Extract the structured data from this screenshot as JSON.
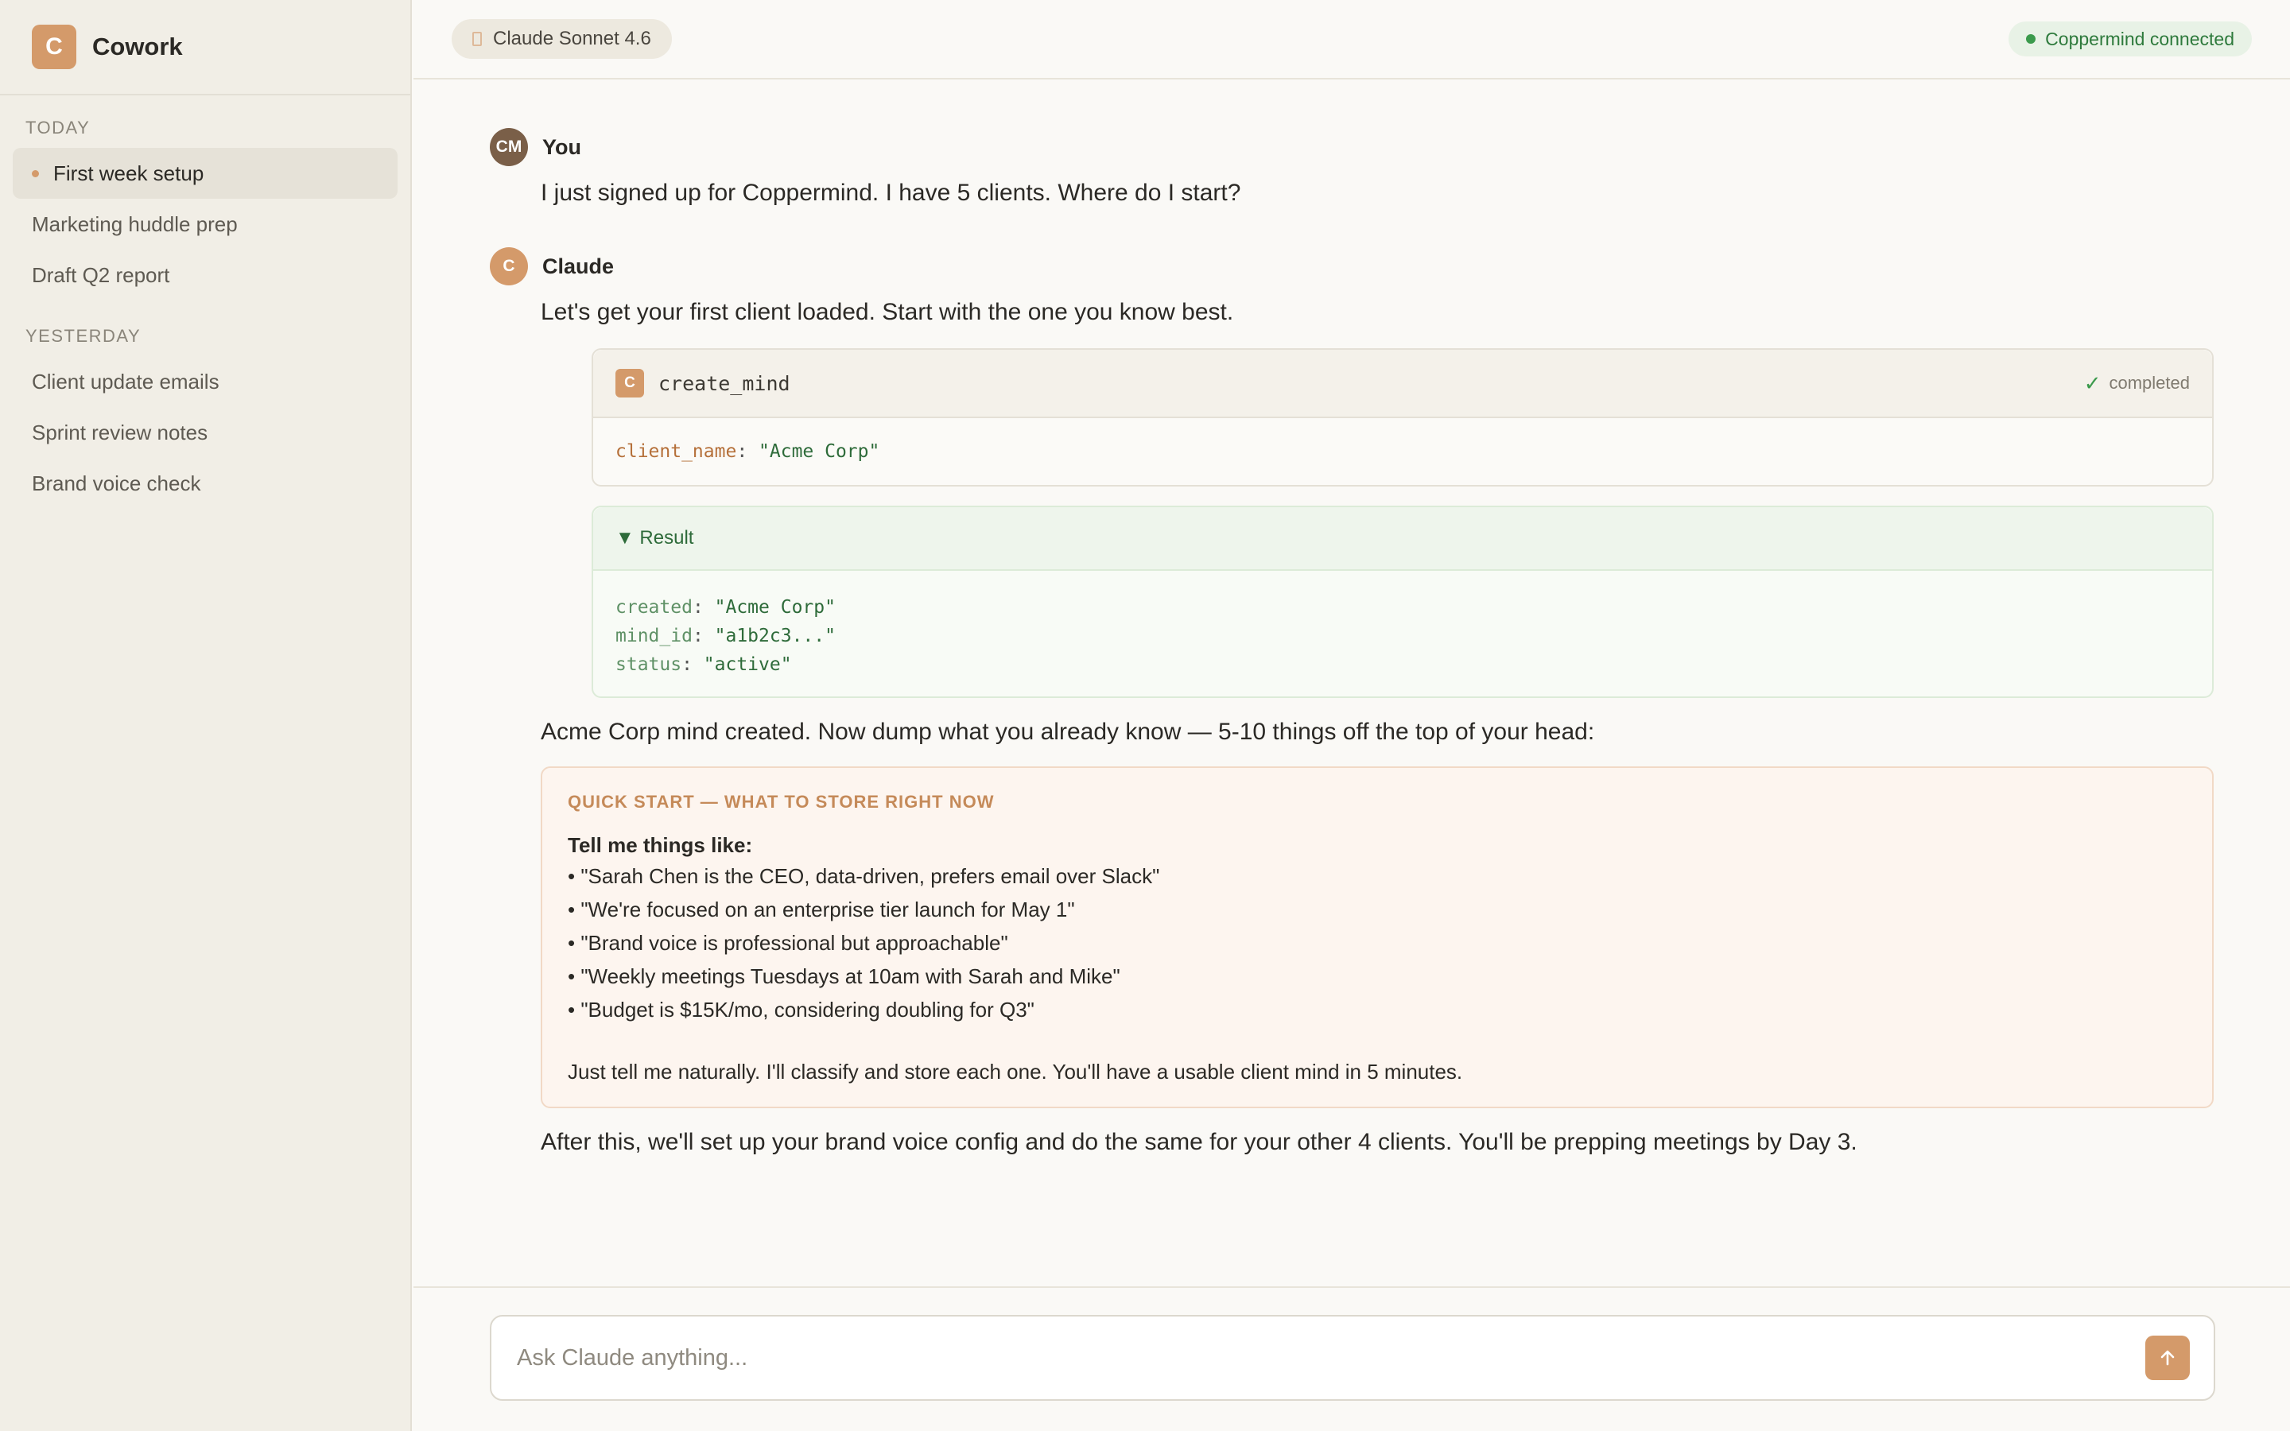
{
  "app": {
    "logo_letter": "C",
    "name": "Cowork"
  },
  "sidebar": {
    "sections": [
      {
        "label": "TODAY",
        "items": [
          "First week setup",
          "Marketing huddle prep",
          "Draft Q2 report"
        ]
      },
      {
        "label": "YESTERDAY",
        "items": [
          "Client update emails",
          "Sprint review notes",
          "Brand voice check"
        ]
      }
    ],
    "active_item": "First week setup"
  },
  "header": {
    "model": "Claude Sonnet 4.6",
    "connection_status": "Coppermind connected"
  },
  "messages": {
    "user": {
      "avatar": "CM",
      "name": "You",
      "text": "I just signed up for Coppermind. I have 5 clients. Where do I start?"
    },
    "assistant": {
      "avatar": "C",
      "name": "Claude",
      "intro": "Let's get your first client loaded. Start with the one you know best.",
      "tool_call": {
        "badge": "C",
        "name": "create_mind",
        "status": "completed",
        "arg_key": "client_name",
        "arg_value": "\"Acme Corp\""
      },
      "result": {
        "label": "▼ Result",
        "lines": [
          {
            "key": "created",
            "value": "\"Acme Corp\""
          },
          {
            "key": "mind_id",
            "value": "\"a1b2c3...\""
          },
          {
            "key": "status",
            "value": "\"active\""
          }
        ]
      },
      "after_tool": "Acme Corp mind created. Now dump what you already know — 5-10 things off the top of your head:",
      "quick_start": {
        "title": "QUICK START — WHAT TO STORE RIGHT NOW",
        "lead": "Tell me things like:",
        "items": [
          "• \"Sarah Chen is the CEO, data-driven, prefers email over Slack\"",
          "• \"We're focused on an enterprise tier launch for May 1\"",
          "• \"Brand voice is professional but approachable\"",
          "• \"Weekly meetings Tuesdays at 10am with Sarah and Mike\"",
          "• \"Budget is $15K/mo, considering doubling for Q3\""
        ],
        "footer": "Just tell me naturally. I'll classify and store each one. You'll have a usable client mind in 5 minutes."
      },
      "closing": "After this, we'll set up your brand voice config and do the same for your other 4 clients. You'll be prepping meetings by Day 3."
    }
  },
  "composer": {
    "placeholder": "Ask Claude anything...",
    "send_icon": "arrow-up-icon"
  },
  "colors": {
    "accent": "#d49a6a",
    "success": "#3b9a4c",
    "sidebar_bg": "#f1eee6"
  }
}
